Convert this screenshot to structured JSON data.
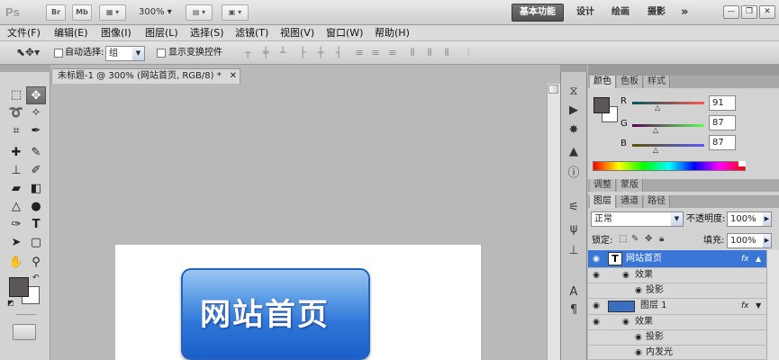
{
  "appbar": {
    "logo": "Ps",
    "br": "Br",
    "mb": "Mb",
    "zoom": "300%",
    "workspaces": {
      "active": "基本功能",
      "others": [
        "设计",
        "绘画",
        "摄影"
      ]
    },
    "more": "»",
    "win_min": "—",
    "win_restore": "❐",
    "win_close": "✕"
  },
  "menu": [
    "文件(F)",
    "编辑(E)",
    "图像(I)",
    "图层(L)",
    "选择(S)",
    "滤镜(T)",
    "视图(V)",
    "窗口(W)",
    "帮助(H)"
  ],
  "options": {
    "auto_select_label": "自动选择:",
    "auto_select_value": "组",
    "show_transform_label": "显示变换控件"
  },
  "document": {
    "tab_title": "未标题-1 @ 300% (网站首页, RGB/8) *",
    "button_text": "网站首页"
  },
  "color_panel": {
    "tabs": [
      "颜色",
      "色板",
      "样式"
    ],
    "r_label": "R",
    "g_label": "G",
    "b_label": "B",
    "r": "91",
    "g": "87",
    "b": "87"
  },
  "adjust_panel": {
    "tabs": [
      "调整",
      "蒙版"
    ]
  },
  "layers_panel": {
    "tabs": [
      "图层",
      "通道",
      "路径"
    ],
    "blend_mode": "正常",
    "opacity_label": "不透明度:",
    "opacity": "100%",
    "lock_label": "锁定:",
    "fill_label": "填充:",
    "fill": "100%",
    "layers": [
      {
        "name": "网站首页",
        "type": "T",
        "fx": "fx",
        "selected": true
      },
      {
        "name": "效果",
        "type": "effect-header"
      },
      {
        "name": "投影",
        "type": "effect"
      },
      {
        "name": "图层 1",
        "type": "raster",
        "fx": "fx"
      },
      {
        "name": "效果",
        "type": "effect-header"
      },
      {
        "name": "投影",
        "type": "effect"
      },
      {
        "name": "内发光",
        "type": "effect"
      }
    ]
  },
  "colors": {
    "fg": "#5b5757",
    "bg": "#ffffff",
    "accent": "#3a76d6"
  }
}
